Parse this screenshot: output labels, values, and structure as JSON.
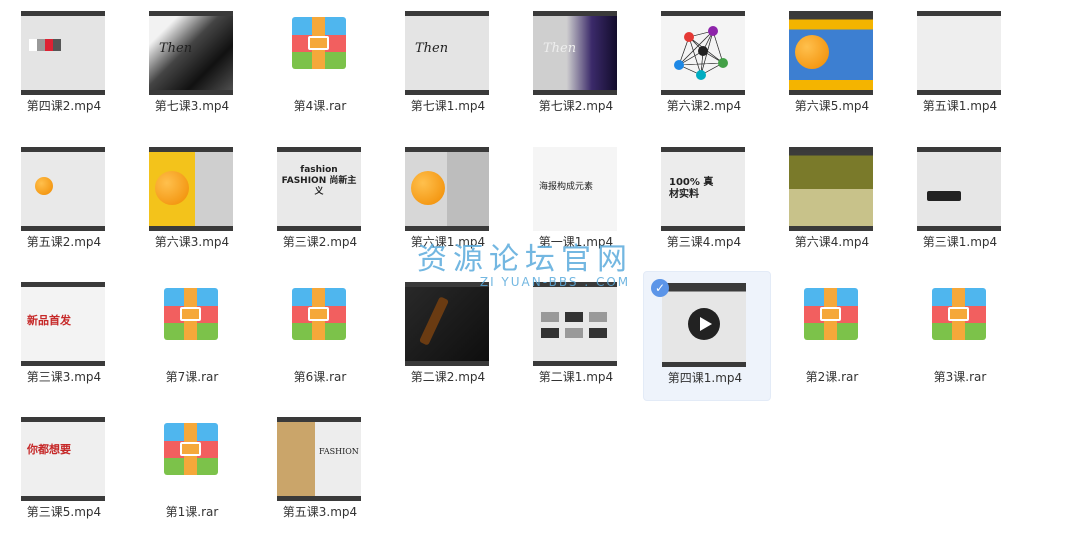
{
  "files": [
    {
      "name": "第四课2.mp4",
      "type": "mp4",
      "theme": "light"
    },
    {
      "name": "第七课3.mp4",
      "type": "mp4",
      "theme": "dark-splash",
      "text": "Then"
    },
    {
      "name": "第4课.rar",
      "type": "rar"
    },
    {
      "name": "第七课1.mp4",
      "type": "mp4",
      "theme": "light",
      "text": "Then"
    },
    {
      "name": "第七课2.mp4",
      "type": "mp4",
      "theme": "purple",
      "text": "Then"
    },
    {
      "name": "第六课2.mp4",
      "type": "mp4",
      "theme": "network"
    },
    {
      "name": "第六课5.mp4",
      "type": "mp4",
      "theme": "blue-orange"
    },
    {
      "name": "第五课1.mp4",
      "type": "mp4",
      "theme": "ui-panel"
    },
    {
      "name": "第五课2.mp4",
      "type": "mp4",
      "theme": "orange-small"
    },
    {
      "name": "第六课3.mp4",
      "type": "mp4",
      "theme": "orange-yellow"
    },
    {
      "name": "第三课2.mp4",
      "type": "mp4",
      "theme": "fashion",
      "text": "fashion FASHION 尚新主义"
    },
    {
      "name": "第六课1.mp4",
      "type": "mp4",
      "theme": "orange-panel"
    },
    {
      "name": "第一课1.mp4",
      "type": "mp4",
      "theme": "poster",
      "text": "海报构成元素"
    },
    {
      "name": "第三课4.mp4",
      "type": "mp4",
      "theme": "percent",
      "text": "100% 真材实料"
    },
    {
      "name": "第六课4.mp4",
      "type": "mp4",
      "theme": "olive"
    },
    {
      "name": "第三课1.mp4",
      "type": "mp4",
      "theme": "router"
    },
    {
      "name": "第三课3.mp4",
      "type": "mp4",
      "theme": "newproduct",
      "text": "新品首发"
    },
    {
      "name": "第7课.rar",
      "type": "rar"
    },
    {
      "name": "第6课.rar",
      "type": "rar"
    },
    {
      "name": "第二课2.mp4",
      "type": "mp4",
      "theme": "bottle"
    },
    {
      "name": "第二课1.mp4",
      "type": "mp4",
      "theme": "tiles"
    },
    {
      "name": "第四课1.mp4",
      "type": "mp4",
      "theme": "play",
      "selected": true
    },
    {
      "name": "第2课.rar",
      "type": "rar"
    },
    {
      "name": "第3课.rar",
      "type": "rar"
    },
    {
      "name": "第三课5.mp4",
      "type": "mp4",
      "theme": "red-text",
      "text": "你都想要"
    },
    {
      "name": "第1课.rar",
      "type": "rar"
    },
    {
      "name": "第五课3.mp4",
      "type": "mp4",
      "theme": "fashion-person",
      "text": "FASHION"
    }
  ],
  "watermark": {
    "title": "资源论坛官网",
    "url": "ZI YUAN-BBS . COM"
  },
  "colors": {
    "rar_blue": "#4fb6ee",
    "rar_red": "#f25f5f",
    "rar_green": "#7cc24a",
    "rar_strap": "#f5a83a",
    "selected_bg": "#eef3fb"
  }
}
